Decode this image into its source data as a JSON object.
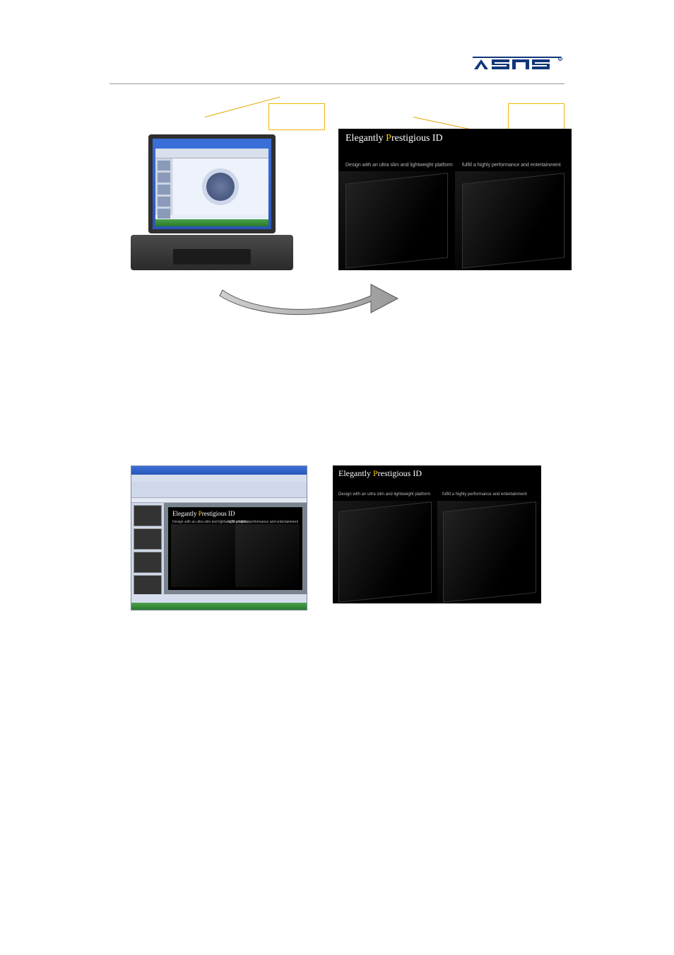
{
  "brand": {
    "name": "ASUS"
  },
  "diagram": {
    "callout_left_label": "",
    "callout_right_label": "",
    "external_slide": {
      "title_prefix": "Elegantly ",
      "title_accent": "P",
      "title_suffix": "restigious ID",
      "subcaption_left": "Design with an ultra slim and lightweight platform",
      "subcaption_right": "fulfill a highly performance and entertainment"
    }
  },
  "row2": {
    "ppt_slide": {
      "title_prefix": "Elegantly ",
      "title_accent": "P",
      "title_suffix": "restigious ID",
      "subcaption_left": "Design with an ultra slim and lightweight platform",
      "subcaption_right": "fulfill a highly performance and entertainment"
    },
    "external_slide": {
      "title_prefix": "Elegantly ",
      "title_accent": "P",
      "title_suffix": "restigious ID",
      "subcaption_left": "Design with an ultra slim and lightweight platform",
      "subcaption_right": "fulfill a highly performance and entertainment"
    }
  }
}
